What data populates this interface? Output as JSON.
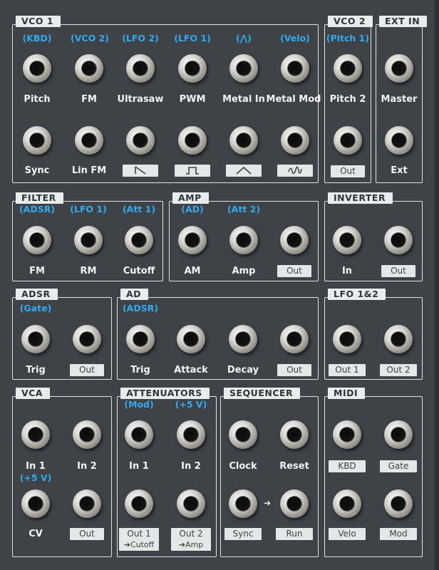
{
  "vco1": {
    "title": "VCO 1",
    "sources": [
      "(KBD)",
      "(VCO 2)",
      "(LFO 2)",
      "(LFO 1)",
      "(⋀)",
      "(Velo)"
    ],
    "row1": [
      "Pitch",
      "FM",
      "Ultrasaw",
      "PWM",
      "Metal In",
      "Metal Mod"
    ],
    "row2": [
      "Sync",
      "Lin FM"
    ],
    "wave_icons": [
      "saw-wave-icon",
      "square-wave-icon",
      "triangle-wave-icon",
      "noise-wave-icon"
    ]
  },
  "vco2": {
    "title": "VCO 2",
    "source": "(Pitch 1)",
    "label": "Pitch 2",
    "out": "Out"
  },
  "extin": {
    "title": "EXT IN",
    "master": "Master",
    "ext": "Ext"
  },
  "filter": {
    "title": "FILTER",
    "sources": [
      "(ADSR)",
      "(LFO 1)",
      "(Att 1)"
    ],
    "labels": [
      "FM",
      "RM",
      "Cutoff"
    ]
  },
  "amp": {
    "title": "AMP",
    "sources": [
      "(AD)",
      "(Att 2)"
    ],
    "labels": [
      "AM",
      "Amp"
    ],
    "out": "Out"
  },
  "inverter": {
    "title": "INVERTER",
    "in": "In",
    "out": "Out"
  },
  "adsr": {
    "title": "ADSR",
    "source": "(Gate)",
    "trig": "Trig",
    "out": "Out"
  },
  "ad": {
    "title": "AD",
    "source": "(ADSR)",
    "labels": [
      "Trig",
      "Attack",
      "Decay"
    ],
    "out": "Out"
  },
  "lfo": {
    "title": "LFO 1&2",
    "out1": "Out 1",
    "out2": "Out 2"
  },
  "vca": {
    "title": "VCA",
    "in1": "In 1",
    "in1_src": "(+5 V)",
    "in2": "In 2",
    "cv": "CV",
    "out": "Out"
  },
  "attenuators": {
    "title": "ATTENUATORS",
    "sources": [
      "(Mod)",
      "(+5 V)"
    ],
    "in1": "In 1",
    "in2": "In 2",
    "out1": "Out 1",
    "out1_dest": "➔Cutoff",
    "out2": "Out 2",
    "out2_dest": "➔Amp"
  },
  "sequencer": {
    "title": "SEQUENCER",
    "clock": "Clock",
    "reset": "Reset",
    "sync": "Sync",
    "run": "Run"
  },
  "midi": {
    "title": "MIDI",
    "kbd": "KBD",
    "gate": "Gate",
    "velo": "Velo",
    "mod": "Mod"
  },
  "colors": {
    "panel": "#3d4347",
    "source_blue": "#35a9ee",
    "line": "#dfe3e6"
  }
}
